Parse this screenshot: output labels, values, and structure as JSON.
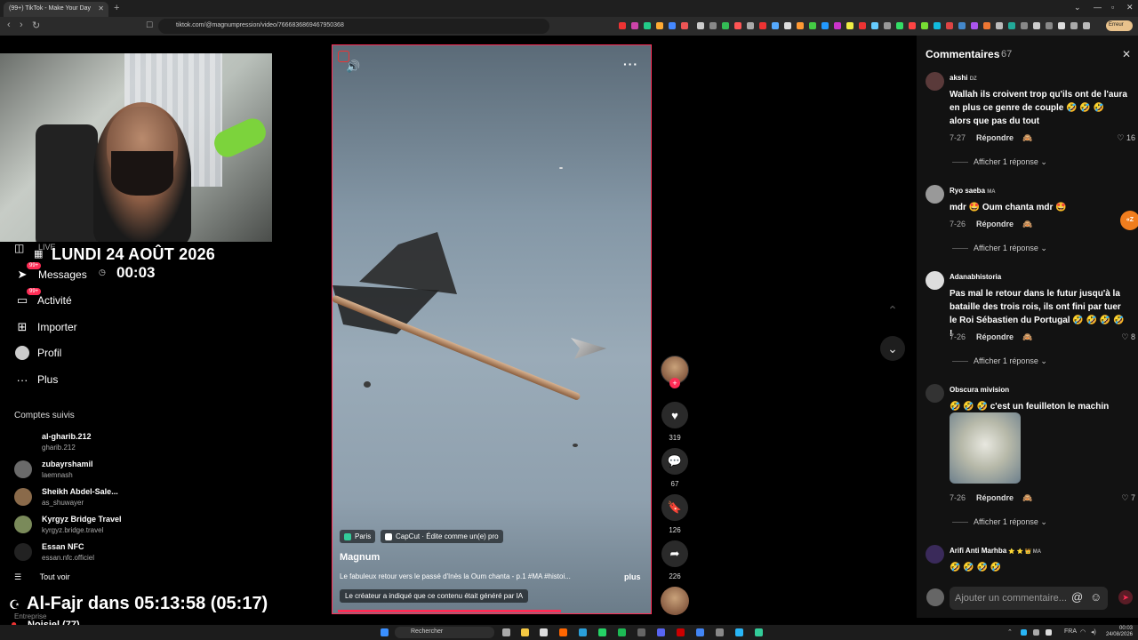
{
  "browser": {
    "tab_title": "(99+) TikTok - Make Your Day",
    "url": "tiktok.com/@magnumpression/video/7666836869467950368",
    "error_pill": "Erreur"
  },
  "overlay": {
    "live_label": "LIVE",
    "date": "LUNDI 24 AOÛT 2026",
    "time": "00:03",
    "prayer": "Al-Fajr dans 05:13:58 (05:17)",
    "enterprise": "Entreprise",
    "location": "Noisiel (77)"
  },
  "sidebar": {
    "messages_badge": "99+",
    "activity_badge": "99+",
    "items": [
      {
        "label": "Messages",
        "icon": "paper-plane-icon"
      },
      {
        "label": "Activité",
        "icon": "inbox-icon"
      },
      {
        "label": "Importer",
        "icon": "plus-square-icon"
      },
      {
        "label": "Profil",
        "icon": "avatar"
      },
      {
        "label": "Plus",
        "icon": "more-dots-icon"
      }
    ],
    "followed_title": "Comptes suivis",
    "followed": [
      {
        "name": "al-gharib.212",
        "handle": "gharib.212"
      },
      {
        "name": "zubayrshamil",
        "handle": "laemnash"
      },
      {
        "name": "Sheikh Abdel-Sale...",
        "handle": "as_shuwayer"
      },
      {
        "name": "Kyrgyz Bridge Travel",
        "handle": "kyrgyz.bridge.travel"
      },
      {
        "name": "Essan NFC",
        "handle": "essan.nfc.officiel"
      }
    ],
    "see_all": "Tout voir"
  },
  "video": {
    "location_chip": "Paris",
    "capcut_chip": "CapCut · Édite comme un(e) pro",
    "author": "Magnum",
    "caption": "Le fabuleux retour vers le passé d'Inès la Oum chanta - p.1 #MA #histoi...",
    "more": "plus",
    "ai_label": "Le créateur a indiqué que ce contenu était généré par IA",
    "progress": 0.72
  },
  "actions": {
    "likes": "319",
    "comments": "67",
    "saves": "126",
    "shares": "226"
  },
  "comments": {
    "title": "Commentaires",
    "count": "67",
    "input_placeholder": "Ajouter un commentaire...",
    "reply_label": "Répondre",
    "items": [
      {
        "user": "akshi",
        "flag": "DZ",
        "text": "Wallah ils croivent trop qu'ils ont de l'aura en plus ce genre de couple 🤣 🤣 🤣 alors que pas du tout",
        "date": "7-27",
        "likes": "16",
        "replies": "Afficher 1 réponse"
      },
      {
        "user": "Ryo saeba",
        "flag": "MA",
        "text": "mdr 🤩 Oum chanta mdr 🤩",
        "date": "7-26",
        "likes": "",
        "replies": "Afficher 1 réponse"
      },
      {
        "user": "Adanabhistoria",
        "flag": "",
        "text": "Pas mal le retour dans le futur jusqu'à la bataille des trois rois, ils ont fini par tuer le Roi Sébastien du Portugal 🤣 🤣 🤣 🤣 !",
        "date": "7-26",
        "likes": "8",
        "replies": "Afficher 1 réponse"
      },
      {
        "user": "Obscura mivision",
        "flag": "",
        "text": "🤣 🤣 🤣 c'est un feuilleton le machin",
        "date": "7-26",
        "likes": "7",
        "replies": "Afficher 1 réponse"
      },
      {
        "user": "Arifi Anti Marhba",
        "flag": "⭐ ⭐ 👑 MA",
        "text": "🤣 🤣 🤣 🤣",
        "date": "",
        "likes": "",
        "replies": ""
      }
    ]
  },
  "taskbar": {
    "search": "Rechercher",
    "lang": "FRA",
    "clock_time": "00:03",
    "clock_date": "24/08/2026"
  }
}
